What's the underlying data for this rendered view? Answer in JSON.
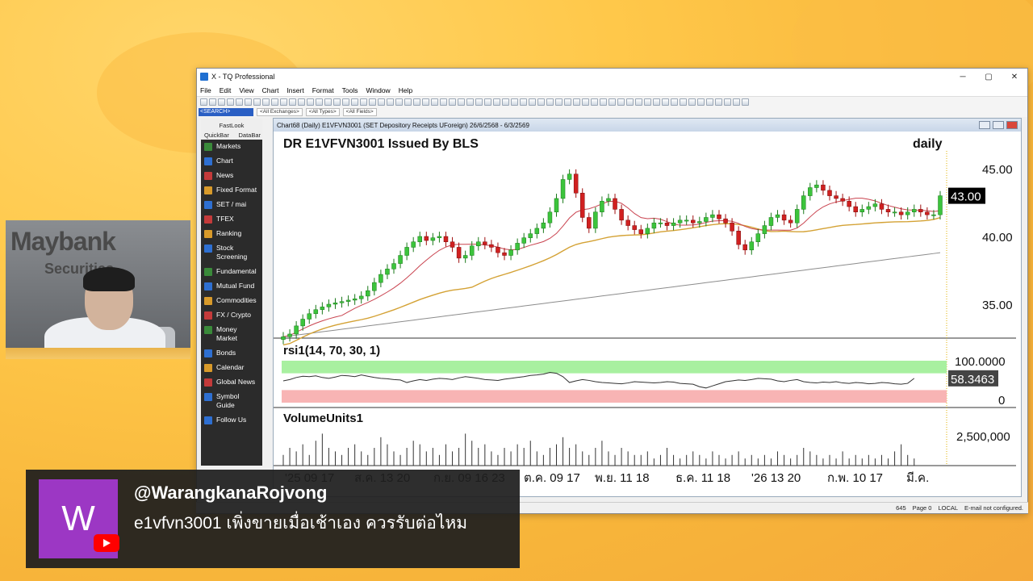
{
  "window": {
    "title": "X - TQ Professional",
    "controls": [
      "─",
      "▢",
      "✕"
    ],
    "menu": [
      "File",
      "Edit",
      "View",
      "Chart",
      "Insert",
      "Format",
      "Tools",
      "Window",
      "Help"
    ],
    "search": "<SEARCH>",
    "dropdowns": [
      "<All Exchanges>",
      "<All Types>",
      "<All Fields>"
    ]
  },
  "sidebar": {
    "header": "FastLook",
    "tabs": [
      "QuickBar",
      "DataBar"
    ],
    "items": [
      {
        "label": "Markets",
        "color": "#3a8a3a"
      },
      {
        "label": "Chart",
        "color": "#2e6fd1"
      },
      {
        "label": "News",
        "color": "#c43a3a"
      },
      {
        "label": "Fixed Format",
        "color": "#d89a2a"
      },
      {
        "label": "SET / mai",
        "color": "#2e6fd1"
      },
      {
        "label": "TFEX",
        "color": "#c43a3a"
      },
      {
        "label": "Ranking",
        "color": "#d89a2a"
      },
      {
        "label": "Stock Screening",
        "color": "#2e6fd1"
      },
      {
        "label": "Fundamental",
        "color": "#3a8a3a"
      },
      {
        "label": "Mutual Fund",
        "color": "#2e6fd1"
      },
      {
        "label": "Commodities",
        "color": "#d89a2a"
      },
      {
        "label": "FX / Crypto",
        "color": "#c43a3a"
      },
      {
        "label": "Money Market",
        "color": "#3a8a3a"
      },
      {
        "label": "Bonds",
        "color": "#2e6fd1"
      },
      {
        "label": "Calendar",
        "color": "#d89a2a"
      },
      {
        "label": "Global News",
        "color": "#c43a3a"
      },
      {
        "label": "Symbol Guide",
        "color": "#2e6fd1"
      },
      {
        "label": "Follow Us",
        "color": "#2e6fd1"
      }
    ]
  },
  "chart_window": {
    "title": "Chart68 (Daily)  E1VFVN3001 (SET Depository Receipts UForeign) 26/6/2568 - 6/3/2569",
    "status": [
      "645",
      "Page 0",
      "LOCAL",
      "E-mail not configured."
    ]
  },
  "chart_data": {
    "type": "candlestick",
    "title": "DR E1VFVN3001 Issued By BLS",
    "period_label": "daily",
    "price_axis": {
      "ticks": [
        "45.00",
        "40.00",
        "35.00"
      ],
      "ylim": [
        32.5,
        47.5
      ]
    },
    "last_price": "43.00",
    "closes": [
      32.6,
      32.8,
      33.4,
      33.9,
      34.3,
      34.6,
      34.8,
      35.0,
      35.1,
      35.2,
      35.3,
      35.4,
      35.6,
      36.0,
      36.6,
      37.2,
      37.6,
      38.0,
      38.6,
      39.2,
      39.6,
      40.0,
      39.7,
      39.9,
      40.0,
      39.6,
      39.2,
      38.4,
      38.6,
      39.3,
      39.6,
      39.4,
      39.2,
      38.8,
      38.6,
      39.0,
      39.5,
      39.9,
      40.2,
      40.6,
      41.0,
      41.8,
      42.8,
      44.2,
      44.6,
      43.2,
      41.4,
      40.6,
      41.8,
      42.6,
      42.8,
      42.0,
      41.2,
      40.8,
      40.5,
      40.2,
      40.6,
      41.0,
      41.0,
      40.8,
      41.0,
      41.2,
      41.2,
      41.0,
      41.1,
      41.4,
      41.6,
      41.3,
      41.0,
      40.4,
      39.4,
      39.0,
      39.6,
      40.2,
      40.8,
      41.4,
      41.6,
      41.2,
      41.0,
      42.0,
      43.0,
      43.6,
      43.8,
      43.4,
      43.0,
      42.8,
      42.6,
      42.2,
      41.8,
      42.0,
      42.2,
      42.4,
      42.0,
      41.8,
      41.8,
      41.6,
      41.8,
      42.0,
      41.8,
      41.6,
      41.6,
      43.0
    ],
    "ma_short": {
      "color": "#c9434f"
    },
    "ma_mid": {
      "color": "#d4a235"
    },
    "ma_long": {
      "color": "#8c8c8c"
    },
    "rsi": {
      "label": "rsi1(14, 70, 30, 1)",
      "ticks": [
        "100.0000",
        "0"
      ],
      "last_value": "58.3463",
      "values": [
        52,
        55,
        60,
        63,
        62,
        64,
        60,
        58,
        61,
        65,
        64,
        62,
        66,
        63,
        60,
        58,
        57,
        55,
        54,
        48,
        52,
        55,
        53,
        56,
        58,
        57,
        55,
        59,
        62,
        60,
        58,
        55,
        54,
        53,
        56,
        58,
        60,
        62,
        65,
        66,
        68,
        72,
        70,
        62,
        48,
        52,
        55,
        53,
        50,
        48,
        47,
        46,
        45,
        47,
        50,
        49,
        48,
        47,
        48,
        50,
        49,
        46,
        45,
        44,
        38,
        35,
        40,
        45,
        50,
        52,
        54,
        53,
        55,
        58,
        57,
        56,
        52,
        50,
        53,
        55,
        50,
        48,
        47,
        49,
        48,
        50,
        47,
        46,
        48,
        47,
        45,
        46,
        48,
        47,
        45,
        44,
        46,
        58
      ]
    },
    "volume": {
      "label": "VolumeUnits1",
      "ticks": [
        "2,500,000"
      ],
      "values": [
        0.3,
        0.5,
        0.4,
        0.6,
        0.3,
        0.7,
        0.9,
        0.5,
        0.4,
        0.3,
        0.5,
        0.6,
        0.4,
        0.3,
        0.5,
        0.8,
        0.6,
        0.4,
        0.3,
        0.5,
        0.7,
        0.6,
        0.4,
        0.5,
        0.3,
        0.6,
        0.4,
        0.5,
        0.9,
        0.7,
        0.5,
        0.6,
        0.4,
        0.3,
        0.5,
        0.4,
        0.6,
        0.5,
        0.7,
        0.4,
        0.3,
        0.5,
        0.6,
        0.8,
        0.5,
        0.6,
        0.4,
        0.3,
        0.5,
        0.7,
        0.4,
        0.3,
        0.5,
        0.4,
        0.3,
        0.3,
        0.4,
        0.2,
        0.3,
        0.5,
        0.3,
        0.2,
        0.3,
        0.4,
        0.3,
        0.2,
        0.4,
        0.3,
        0.2,
        0.3,
        0.4,
        0.2,
        0.3,
        0.2,
        0.3,
        0.2,
        0.4,
        0.3,
        0.2,
        0.3,
        0.5,
        0.4,
        0.3,
        0.2,
        0.3,
        0.2,
        0.4,
        0.2,
        0.3,
        0.2,
        0.3,
        0.2,
        0.3,
        0.2,
        0.4,
        0.6,
        0.3,
        0.2
      ]
    },
    "x_labels": [
      "'25 09 17",
      "ส.ค. 13 20",
      "ก.ย. 09 16 23",
      "ต.ค. 09 17",
      "พ.ย. 11 18",
      "ธ.ค. 11 18",
      "'26 13 20",
      "ก.พ. 10 17",
      "มี.ค."
    ]
  },
  "webcam": {
    "logo": "Maybank",
    "logo_sub": "Securities"
  },
  "comment": {
    "avatar_letter": "W",
    "handle": "@WarangkanaRojvong",
    "message": "e1vfvn3001 เพิ่งขายเมื่อเช้าเอง ควรรับต่อไหม"
  }
}
